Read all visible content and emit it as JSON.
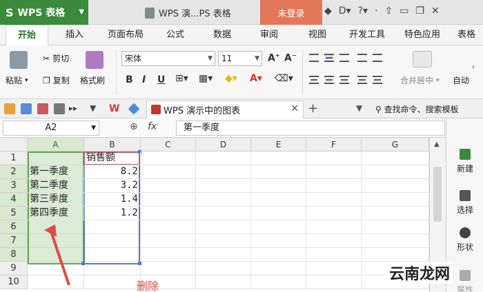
{
  "app": {
    "brand": "WPS 表格",
    "doc_title": "WPS 演...PS 表格",
    "login": "未登录"
  },
  "tabs": [
    "开始",
    "插入",
    "页面布局",
    "公式",
    "数据",
    "审阅",
    "视图",
    "开发工具",
    "特色应用",
    "表格"
  ],
  "ribbon": {
    "paste": "粘贴",
    "cut": "剪切",
    "copy": "复制",
    "format_painter": "格式刷",
    "font_name": "宋体",
    "font_size": "11",
    "merge_center": "合并居中",
    "auto_wrap": "自动"
  },
  "quick": {
    "doc_tab": "WPS 演示中的图表",
    "search_cmd": "查找命令、搜索模板"
  },
  "formula_bar": {
    "name_box": "A2",
    "fx": "fx",
    "content": "第一季度"
  },
  "sheet": {
    "columns": [
      "A",
      "B",
      "C",
      "D",
      "E",
      "F",
      "G"
    ],
    "rows": [
      "1",
      "2",
      "3",
      "4",
      "5",
      "6",
      "7",
      "8",
      "9",
      "10"
    ],
    "header_b1": "销售额",
    "data": [
      {
        "a": "第一季度",
        "b": "8.2"
      },
      {
        "a": "第二季度",
        "b": "3.2"
      },
      {
        "a": "第三季度",
        "b": "1.4"
      },
      {
        "a": "第四季度",
        "b": "1.2"
      }
    ]
  },
  "side_panel": {
    "new": "新建",
    "select": "选择",
    "shape": "形状",
    "property": "属性"
  },
  "annotation": {
    "delete_label": "删除",
    "watermark": "云南龙网"
  },
  "colors": {
    "accent_green": "#3a8b3c",
    "login_orange": "#e2775a",
    "annotation_red": "#e24a4a"
  }
}
